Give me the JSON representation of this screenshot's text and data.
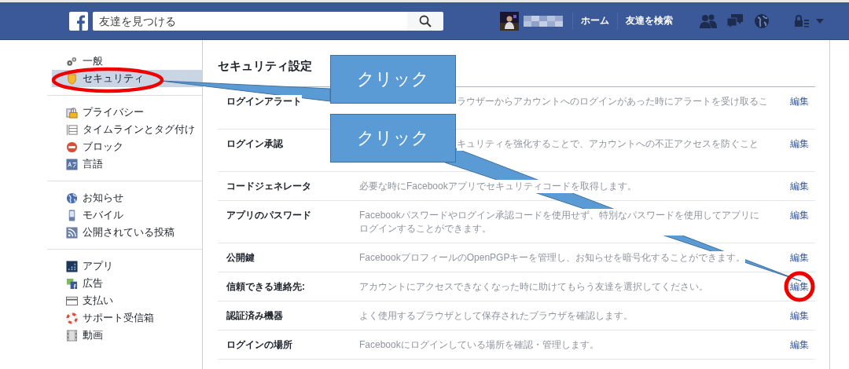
{
  "topbar": {
    "search": {
      "placeholder": "友達を見つける"
    },
    "nav": [
      "ホーム",
      "友達を検索"
    ]
  },
  "sidebar": {
    "groups": [
      [
        {
          "label": "一般",
          "selected": false
        },
        {
          "label": "セキュリティ",
          "selected": true
        }
      ],
      [
        {
          "label": "プライバシー",
          "selected": false
        },
        {
          "label": "タイムラインとタグ付け",
          "selected": false
        },
        {
          "label": "ブロック",
          "selected": false
        },
        {
          "label": "言語",
          "selected": false
        }
      ],
      [
        {
          "label": "お知らせ",
          "selected": false
        },
        {
          "label": "モバイル",
          "selected": false
        },
        {
          "label": "公開されている投稿",
          "selected": false
        }
      ],
      [
        {
          "label": "アプリ",
          "selected": false
        },
        {
          "label": "広告",
          "selected": false
        },
        {
          "label": "支払い",
          "selected": false
        },
        {
          "label": "サポート受信箱",
          "selected": false
        },
        {
          "label": "動画",
          "selected": false
        }
      ]
    ]
  },
  "content": {
    "title": "セキュリティ設定",
    "rows": [
      {
        "label": "ログインアラート",
        "description": "ラウザーからアカウントへのログインがあった時にアラートを受け取るこ",
        "edit": "編集"
      },
      {
        "label": "ログイン承認",
        "description": "キュリティを強化することで、アカウントへの不正アクセスを防ぐこと",
        "edit": "編集"
      },
      {
        "label": "コードジェネレータ",
        "description": "必要な時にFacebookアプリでセキュリティコードを取得します。",
        "edit": "編集"
      },
      {
        "label": "アプリのパスワード",
        "description": "Facebookパスワードやログイン承認コードを使用せず、特別なパスワードを使用してアプリにログインすることができます。",
        "edit": "編集"
      },
      {
        "label": "公開鍵",
        "description": "FacebookプロフィールのOpenPGPキーを管理し、お知らせを暗号化することができます。",
        "edit": "編集"
      },
      {
        "label": "信頼できる連絡先:",
        "description": "アカウントにアクセスできなくなった時に助けてもらう友達を選択してください。",
        "edit": "編集"
      },
      {
        "label": "認証済み機器",
        "description": "よく使用するブラウザとして保存されたブラウザを確認します。",
        "edit": "編集"
      },
      {
        "label": "ログインの場所",
        "description": "Facebookにログインしている場所を確認・管理します。",
        "edit": "編集"
      }
    ]
  },
  "annotations": {
    "callouts": [
      {
        "text": "クリック"
      },
      {
        "text": "クリック"
      }
    ],
    "marks": [
      {
        "kind": "ellipse"
      },
      {
        "kind": "circle"
      }
    ]
  }
}
